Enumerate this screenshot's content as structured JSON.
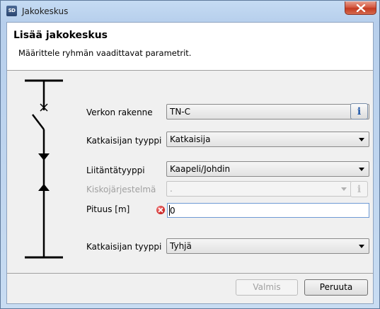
{
  "window": {
    "app_icon_text": "SD",
    "title": "Jakokeskus"
  },
  "header": {
    "title": "Lisää jakokeskus",
    "description": "Määrittele ryhmän vaadittavat parametrit."
  },
  "form": {
    "verkon_rakenne": {
      "label": "Verkon rakenne",
      "value": "TN-C",
      "info": "i"
    },
    "katkaisijan_tyyppi_1": {
      "label": "Katkaisijan tyyppi",
      "value": "Katkaisija"
    },
    "liitantatyyppi": {
      "label": "Liitäntätyyppi",
      "value": "Kaapeli/Johdin"
    },
    "kiskojarjestelma": {
      "label": "Kiskojärjestelmä",
      "value": ".",
      "info": "i"
    },
    "pituus": {
      "label": "Pituus [m]",
      "value": "0"
    },
    "katkaisijan_tyyppi_2": {
      "label": "Katkaisijan tyyppi",
      "value": "Tyhjä"
    }
  },
  "footer": {
    "finish_label": "Valmis",
    "cancel_label": "Peruuta"
  },
  "colors": {
    "error": "#d12a2a",
    "info": "#1d56a8",
    "titlebar": "#b7cfec",
    "close": "#c43a20"
  },
  "icons": [
    "app-icon",
    "close-icon",
    "info-icon",
    "error-icon",
    "chevron-down-icon",
    "circuit-diagram"
  ]
}
